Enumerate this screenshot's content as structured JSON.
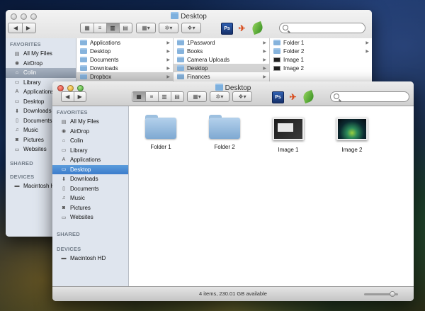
{
  "back_window": {
    "title": "Desktop",
    "sidebar": {
      "favorites_header": "FAVORITES",
      "items": [
        {
          "label": "All My Files",
          "icon": "all-files-icon"
        },
        {
          "label": "AirDrop",
          "icon": "airdrop-icon"
        },
        {
          "label": "Colin",
          "icon": "home-icon",
          "selected": true
        },
        {
          "label": "Library",
          "icon": "folder-icon"
        },
        {
          "label": "Applications",
          "icon": "applications-icon"
        },
        {
          "label": "Desktop",
          "icon": "desktop-icon"
        },
        {
          "label": "Downloads",
          "icon": "downloads-icon"
        },
        {
          "label": "Documents",
          "icon": "documents-icon"
        },
        {
          "label": "Music",
          "icon": "music-icon"
        },
        {
          "label": "Pictures",
          "icon": "pictures-icon"
        },
        {
          "label": "Websites",
          "icon": "folder-icon"
        }
      ],
      "shared_header": "SHARED",
      "devices_header": "DEVICES",
      "devices": [
        {
          "label": "Macintosh HD",
          "icon": "hard-drive-icon"
        }
      ]
    },
    "columns": [
      {
        "rows": [
          {
            "label": "Applications"
          },
          {
            "label": "Desktop"
          },
          {
            "label": "Documents"
          },
          {
            "label": "Downloads"
          },
          {
            "label": "Dropbox",
            "selected": true
          }
        ]
      },
      {
        "rows": [
          {
            "label": "1Password"
          },
          {
            "label": "Books"
          },
          {
            "label": "Camera Uploads"
          },
          {
            "label": "Desktop",
            "selected": true
          },
          {
            "label": "Finances"
          }
        ]
      },
      {
        "rows": [
          {
            "label": "Folder 1",
            "kind": "folder"
          },
          {
            "label": "Folder 2",
            "kind": "folder"
          },
          {
            "label": "Image 1",
            "kind": "image"
          },
          {
            "label": "Image 2",
            "kind": "image"
          }
        ]
      }
    ]
  },
  "front_window": {
    "title": "Desktop",
    "sidebar": {
      "favorites_header": "FAVORITES",
      "items": [
        {
          "label": "All My Files",
          "icon": "all-files-icon"
        },
        {
          "label": "AirDrop",
          "icon": "airdrop-icon"
        },
        {
          "label": "Colin",
          "icon": "home-icon"
        },
        {
          "label": "Library",
          "icon": "folder-icon"
        },
        {
          "label": "Applications",
          "icon": "applications-icon"
        },
        {
          "label": "Desktop",
          "icon": "desktop-icon",
          "selected": true
        },
        {
          "label": "Downloads",
          "icon": "downloads-icon"
        },
        {
          "label": "Documents",
          "icon": "documents-icon"
        },
        {
          "label": "Music",
          "icon": "music-icon"
        },
        {
          "label": "Pictures",
          "icon": "pictures-icon"
        },
        {
          "label": "Websites",
          "icon": "folder-icon"
        }
      ],
      "shared_header": "SHARED",
      "devices_header": "DEVICES",
      "devices": [
        {
          "label": "Macintosh HD",
          "icon": "hard-drive-icon"
        }
      ]
    },
    "items": [
      {
        "label": "Folder 1",
        "kind": "folder"
      },
      {
        "label": "Folder 2",
        "kind": "folder"
      },
      {
        "label": "Image 1",
        "kind": "image"
      },
      {
        "label": "Image 2",
        "kind": "image"
      }
    ],
    "status": "4 items, 230.01 GB available",
    "icon_size_fraction": 0.9
  },
  "toolbar": {
    "ps_label": "Ps",
    "back_glyph": "◀",
    "forward_glyph": "▶",
    "view_glyphs": [
      "▦",
      "≡",
      "▥",
      "▤"
    ],
    "arrange_glyph": "▦▾",
    "action_glyph": "✲▾",
    "dropbox_glyph": "❖▾",
    "bird_glyph": "✈"
  },
  "icons": {
    "all-files-icon": "▤",
    "airdrop-icon": "◉",
    "home-icon": "⌂",
    "folder-icon": "▭",
    "applications-icon": "A",
    "desktop-icon": "▭",
    "downloads-icon": "⬇",
    "documents-icon": "▯",
    "music-icon": "♫",
    "pictures-icon": "◙",
    "hard-drive-icon": "▬"
  },
  "colors": {
    "selection": "#3b7ccb",
    "sidebar_bg": "#dfe5ee"
  }
}
